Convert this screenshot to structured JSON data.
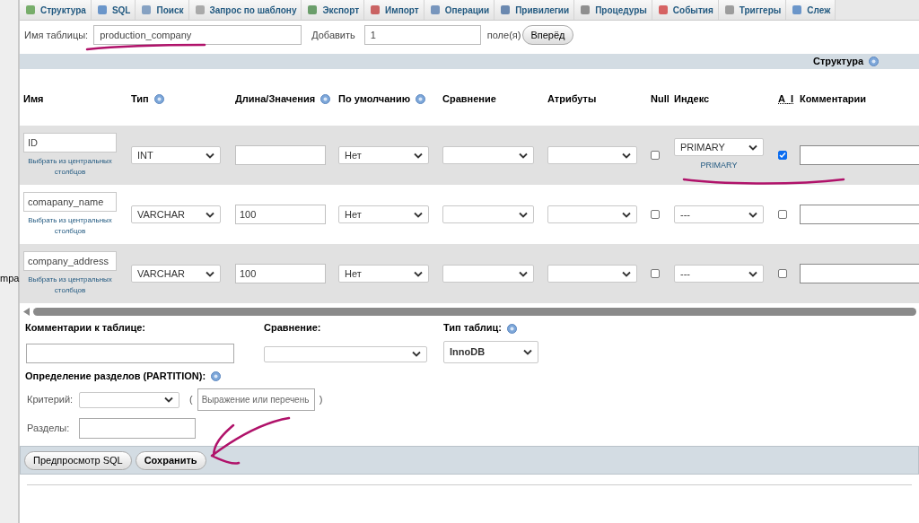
{
  "sidebar": {
    "cut_text": "mpa"
  },
  "tabs": [
    {
      "label": "Структура"
    },
    {
      "label": "SQL"
    },
    {
      "label": "Поиск"
    },
    {
      "label": "Запрос по шаблону"
    },
    {
      "label": "Экспорт"
    },
    {
      "label": "Импорт"
    },
    {
      "label": "Операции"
    },
    {
      "label": "Привилегии"
    },
    {
      "label": "Процедуры"
    },
    {
      "label": "События"
    },
    {
      "label": "Триггеры"
    },
    {
      "label": "Слеж"
    }
  ],
  "table_name": {
    "label": "Имя таблицы:",
    "value": "production_company"
  },
  "add": {
    "label": "Добавить",
    "value": "1",
    "suffix": "поле(я)",
    "button": "Вперёд"
  },
  "section_title": "Структура",
  "columns": [
    {
      "label": "Имя",
      "help": false
    },
    {
      "label": "Тип",
      "help": true
    },
    {
      "label": "Длина/Значения",
      "help": true
    },
    {
      "label": "По умолчанию",
      "help": true
    },
    {
      "label": "Сравнение",
      "help": false
    },
    {
      "label": "Атрибуты",
      "help": false
    },
    {
      "label": "Null",
      "help": false
    },
    {
      "label": "Индекс",
      "help": false
    },
    {
      "label": "A_I",
      "help": false
    },
    {
      "label": "Комментарии",
      "help": false
    }
  ],
  "fields": [
    {
      "name": "ID",
      "central_link": "Выбрать из центральных столбцов",
      "type": "INT",
      "default": "Нет",
      "null": false,
      "index": "PRIMARY",
      "index_label": "PRIMARY",
      "auto_increment": true
    },
    {
      "name": "comapany_name",
      "central_link": "Выбрать из центральных столбцов",
      "type": "VARCHAR",
      "length": "100",
      "default": "Нет",
      "null": false,
      "index": "---",
      "auto_increment": false
    },
    {
      "name": "company_address",
      "central_link": "Выбрать из центральных столбцов",
      "type": "VARCHAR",
      "length": "100",
      "default": "Нет",
      "null": false,
      "index": "---",
      "auto_increment": false
    }
  ],
  "table_comment": {
    "label": "Комментарии к таблице:"
  },
  "collation": {
    "label": "Сравнение:"
  },
  "engine": {
    "label": "Тип таблиц:",
    "value": "InnoDB"
  },
  "partition": {
    "label": "Определение разделов (PARTITION):",
    "criterion_label": "Критерий:",
    "open_paren": "(",
    "expression_placeholder": "Выражение или перечень",
    "close_paren": ")",
    "partitions_label": "Разделы:"
  },
  "buttons": [
    {
      "label": "Предпросмотр SQL"
    },
    {
      "label": "Сохранить"
    }
  ]
}
